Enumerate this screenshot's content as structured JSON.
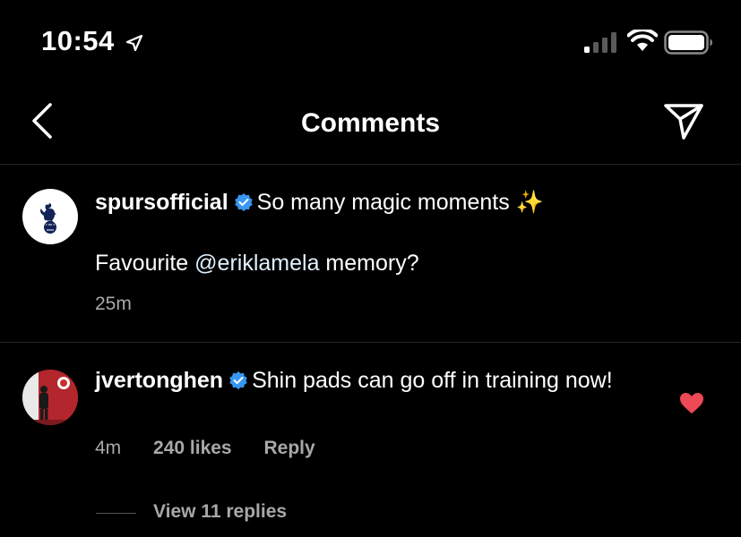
{
  "status_bar": {
    "time": "10:54"
  },
  "header": {
    "title": "Comments"
  },
  "caption": {
    "username": "spursofficial",
    "text": "So many magic moments",
    "emoji": "✨",
    "line2_prefix": "Favourite ",
    "mention": "@eriklamela",
    "line2_suffix": " memory?",
    "time": "25m"
  },
  "comment": {
    "username": "jvertonghen",
    "text": "Shin pads can go off in training now!",
    "time": "4m",
    "likes": "240 likes",
    "reply_label": "Reply",
    "liked": true,
    "view_replies": "View 11 replies"
  },
  "colors": {
    "background": "#000000",
    "secondary_text": "#a8a8a8",
    "verified": "#3897f0",
    "heart": "#ed4956",
    "divider": "#262626"
  },
  "icons": [
    "location-arrow-icon",
    "cellular-signal-icon",
    "wifi-icon",
    "battery-icon",
    "back-chevron-icon",
    "send-direct-icon",
    "verified-badge-icon",
    "heart-icon"
  ]
}
